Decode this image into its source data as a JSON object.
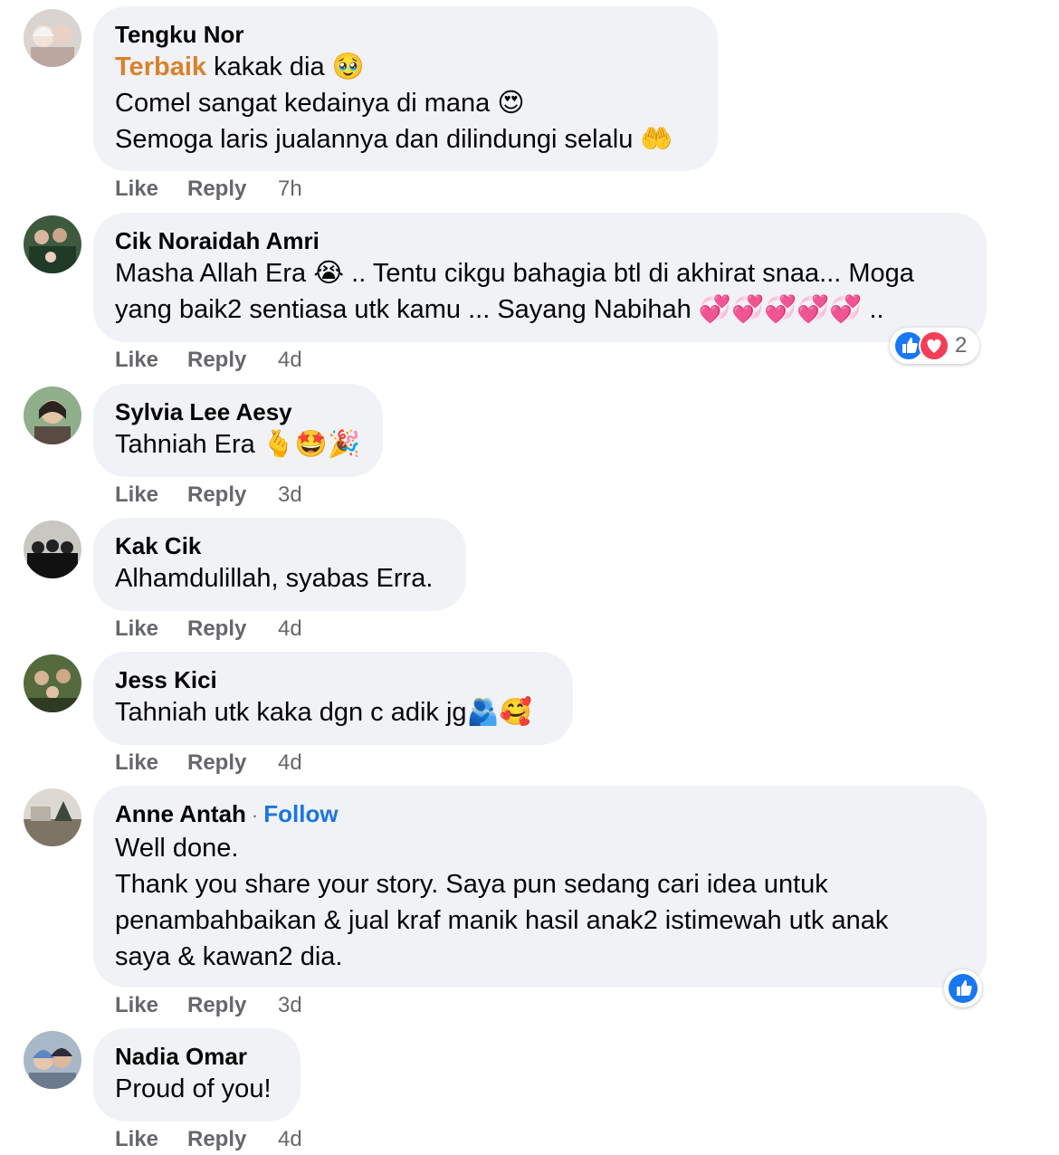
{
  "comments": [
    {
      "author": "Tengku Nor",
      "lines": [
        "kakak dia 🥹",
        "Comel sangat kedainya di mana 😍",
        "Semoga laris jualannya dan dilindungi selalu 🤲"
      ],
      "highlight": "Terbaik",
      "like": "Like",
      "reply": "Reply",
      "time": "7h"
    },
    {
      "author": "Cik Noraidah Amri",
      "lines": [
        "Masha Allah Era 😭 .. Tentu cikgu bahagia btl di akhirat snaa... Moga",
        "yang baik2 sentiasa utk kamu ... Sayang Nabihah 💞💞💞💞💞 .."
      ],
      "like": "Like",
      "reply": "Reply",
      "time": "4d",
      "reactions": {
        "icons": [
          "like-icon",
          "love-icon"
        ],
        "count": "2"
      }
    },
    {
      "author": "Sylvia Lee Aesy",
      "lines": [
        "Tahniah Era 🫰🤩🎉"
      ],
      "like": "Like",
      "reply": "Reply",
      "time": "3d"
    },
    {
      "author": "Kak Cik",
      "lines": [
        "Alhamdulillah, syabas Erra."
      ],
      "like": "Like",
      "reply": "Reply",
      "time": "4d"
    },
    {
      "author": "Jess Kici",
      "lines": [
        "Tahniah utk kaka dgn c adik jg🫂🥰"
      ],
      "like": "Like",
      "reply": "Reply",
      "time": "4d"
    },
    {
      "author": "Anne Antah",
      "follow_separator": "·",
      "follow": "Follow",
      "lines": [
        "Well done.",
        "Thank you share your story. Saya pun sedang cari idea untuk",
        "penambahbaikan & jual kraf manik hasil anak2 istimewah utk anak",
        "saya & kawan2 dia."
      ],
      "like": "Like",
      "reply": "Reply",
      "time": "3d",
      "reactions": {
        "icons": [
          "like-icon"
        ]
      }
    },
    {
      "author": "Nadia Omar",
      "lines": [
        "Proud of you!"
      ],
      "like": "Like",
      "reply": "Reply",
      "time": "4d"
    }
  ],
  "colors": {
    "bubble": "#f0f2f5",
    "link_blue": "#1b74e4",
    "highlight_orange": "#d9822b",
    "secondary_text": "#65676b",
    "like_blue": "#1877f2",
    "love_red": "#f33e58"
  }
}
